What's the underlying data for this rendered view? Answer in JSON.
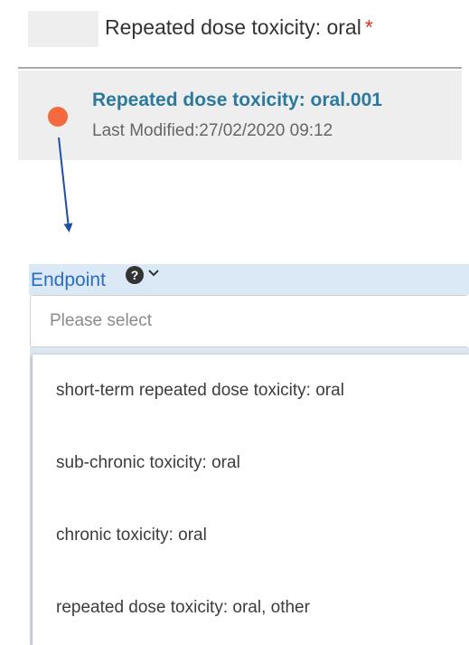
{
  "header": {
    "title": "Repeated dose toxicity: oral",
    "required_marker": "*"
  },
  "record": {
    "title": "Repeated dose toxicity: oral.001",
    "last_modified": "Last Modified:27/02/2020 09:12",
    "status_color": "#f26a3d"
  },
  "field": {
    "label": "Endpoint",
    "help_glyph": "?",
    "placeholder": "Please select",
    "options": [
      "short-term repeated dose toxicity: oral",
      "sub-chronic toxicity: oral",
      "chronic toxicity: oral",
      "repeated dose toxicity: oral, other"
    ]
  },
  "colors": {
    "accent": "#2a6ebf",
    "link": "#2b7a9e",
    "required": "#d9342b",
    "arrow": "#1e4fa0"
  }
}
